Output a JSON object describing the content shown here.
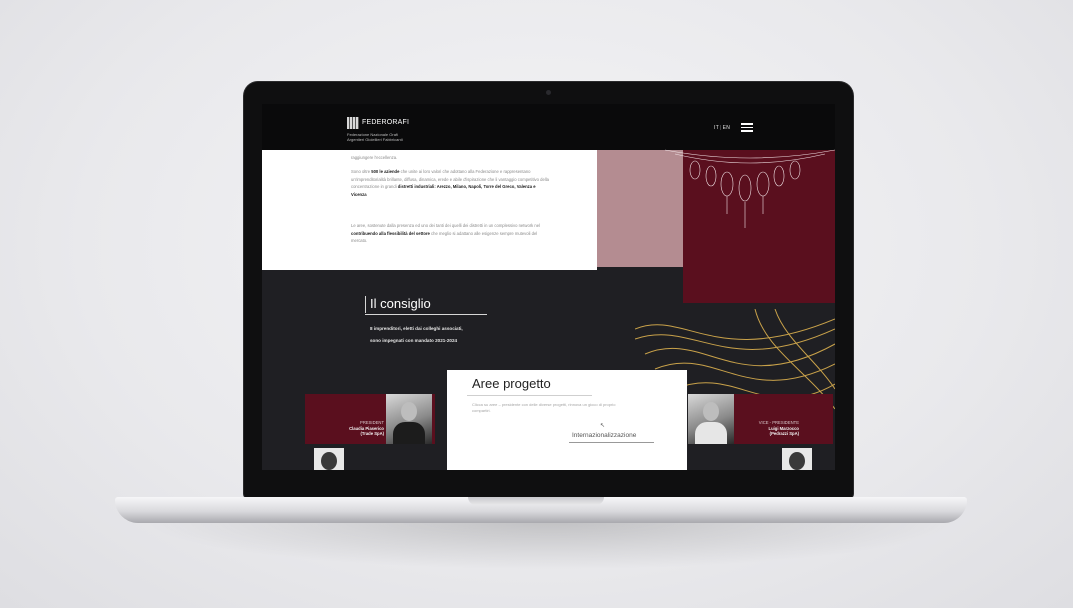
{
  "brand": {
    "name": "FEDERORAFI",
    "tagline_line1": "Federazione Nazionale Orafi",
    "tagline_line2": "Argentieri Gioiellieri Fabbricanti"
  },
  "nav": {
    "lang_it": "IT",
    "lang_sep": "|",
    "lang_en": "EN",
    "menu_icon": "hamburger-icon"
  },
  "intro": {
    "p1": "raggiungere l'eccellenza.",
    "p2_pre": "Sono oltre ",
    "p2_bold": "500 le aziende",
    "p2_post": " che unite ai loro valori che adottano alla Federazione e rappresentano un'imprenditorialità brillante, diffusa, dinamica, erede e abile d'ispirazione che li vantaggio competitivo della concentrazione in grandi ",
    "p2_bold2": "distretti industriali: Arezzo, Milano, Napoli, Torre del Greco, Valenza e Vicenza",
    "p3_pre": "Le aree, sostenute dalla presenza ed uno dei tanti dei quelli dei distretti in un complessivo network nel ",
    "p3_bold": "contribuendo alla flessibilità del settore",
    "p3_post": " che meglio si adattano alle esigenze sempre mutevoli del mercato."
  },
  "consiglio": {
    "title": "Il consiglio",
    "line1": "8 imprenditori, eletti dai colleghi associati,",
    "line2": "sono impegnati con mandato 2021-2024"
  },
  "people": {
    "left_role": "PRESIDENT",
    "left_name1": "Claudia Piaserico",
    "left_name2": "(Trade SpA)",
    "right_role": "VICE - PRESIDENTE",
    "right_name1": "Luigi Marzocco",
    "right_name2": "(Pedrazzi SpA)"
  },
  "aree": {
    "title": "Aree progetto",
    "desc": "Clicca su aree – presidente con delle diverse progetti, rinnova un gioco di proprio compartiri.",
    "tab": "Internazionalizzazione"
  },
  "colors": {
    "maroon": "#5a0f1e",
    "dusty_pink": "#b48c91",
    "dark": "#1f1f23",
    "gold": "#c9a24a"
  }
}
